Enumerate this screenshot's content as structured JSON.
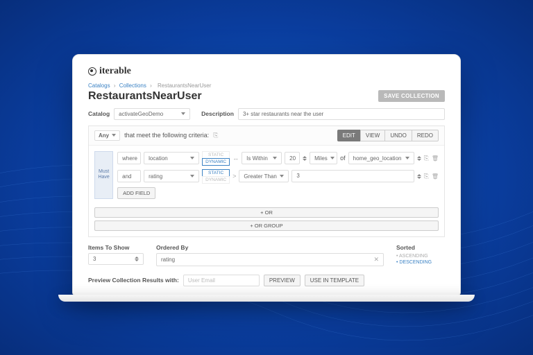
{
  "brand": "iterable",
  "breadcrumb": [
    "Catalogs",
    "Collections",
    "RestaurantsNearUser"
  ],
  "title": "RestaurantsNearUser",
  "save_button": "SAVE COLLECTION",
  "catalog_label": "Catalog",
  "catalog_value": "activateGeoDemo",
  "description_label": "Description",
  "description_value": "3+ star restaurants near the user",
  "criteria": {
    "scope": "Any",
    "scope_suffix": "that meet the following criteria:",
    "buttons": {
      "edit": "EDIT",
      "view": "VIEW",
      "undo": "UNDO",
      "redo": "REDO"
    },
    "must_label": "Must Have",
    "rows": [
      {
        "conj": "where",
        "field": "location",
        "mode_static": "STATIC",
        "mode_dynamic": "DYNAMIC",
        "mode_active": "dynamic",
        "op_icon": "arrows",
        "op": "Is Within",
        "value": "20",
        "unit": "Miles",
        "of_label": "of",
        "target": "home_geo_location"
      },
      {
        "conj": "and",
        "field": "rating",
        "mode_static": "STATIC",
        "mode_dynamic": "DYNAMIC",
        "mode_active": "static",
        "op_icon": "gt",
        "op": "Greater Than",
        "value": "3"
      }
    ],
    "add_field": "ADD FIELD",
    "or": "+ OR",
    "or_group": "+ OR GROUP"
  },
  "items_to_show_label": "Items To Show",
  "items_to_show_value": "3",
  "ordered_by_label": "Ordered By",
  "ordered_by_value": "rating",
  "sorted_label": "Sorted",
  "sorted_asc": "ASCENDING",
  "sorted_desc": "DESCENDING",
  "preview_label": "Preview Collection Results with:",
  "preview_placeholder": "User Email",
  "preview_button": "PREVIEW",
  "use_template_button": "USE IN TEMPLATE"
}
